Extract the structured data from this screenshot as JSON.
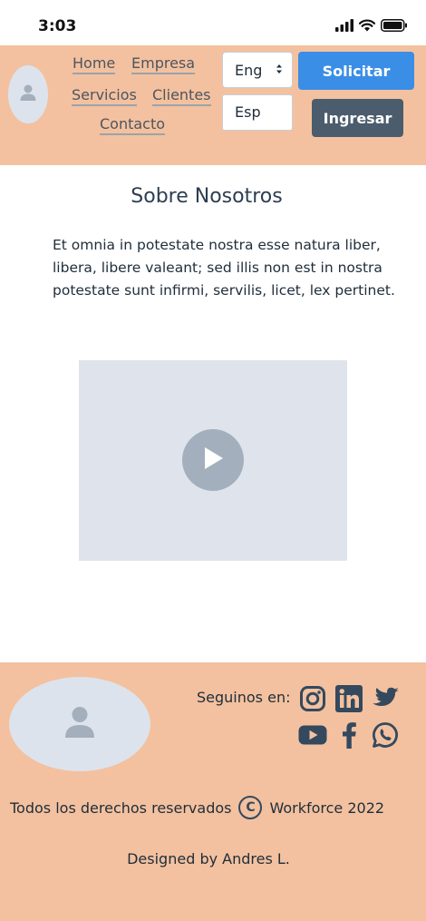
{
  "status_bar": {
    "time": "3:03",
    "icons": [
      "signal-icon",
      "wifi-icon",
      "battery-icon"
    ]
  },
  "header": {
    "nav": {
      "home": "Home",
      "empresa": "Empresa",
      "servicios": "Servicios",
      "clientes": "Clientes",
      "contacto": "Contacto"
    },
    "language": {
      "selected": "Eng",
      "alternate": "Esp"
    },
    "buttons": {
      "solicitar": "Solicitar",
      "ingresar": "Ingresar"
    },
    "colors": {
      "background": "#f3c19f",
      "primary": "#3a8ee6",
      "secondary": "#4b5c6c"
    }
  },
  "about": {
    "title": "Sobre Nosotros",
    "body": "Et omnia in potestate nostra esse natura liber, libera, libere valeant; sed illis non est in nostra potestate sunt infirmi, servilis, licet, lex pertinet."
  },
  "video": {
    "icon": "play-icon"
  },
  "footer": {
    "follow_label": "Seguinos en:",
    "socials": [
      "instagram-icon",
      "linkedin-icon",
      "twitter-icon",
      "youtube-icon",
      "facebook-icon",
      "whatsapp-icon"
    ],
    "rights": "Todos los derechos reservados",
    "copyright_symbol": "C",
    "company": "Workforce 2022",
    "designed_by": "Designed by Andres L."
  }
}
